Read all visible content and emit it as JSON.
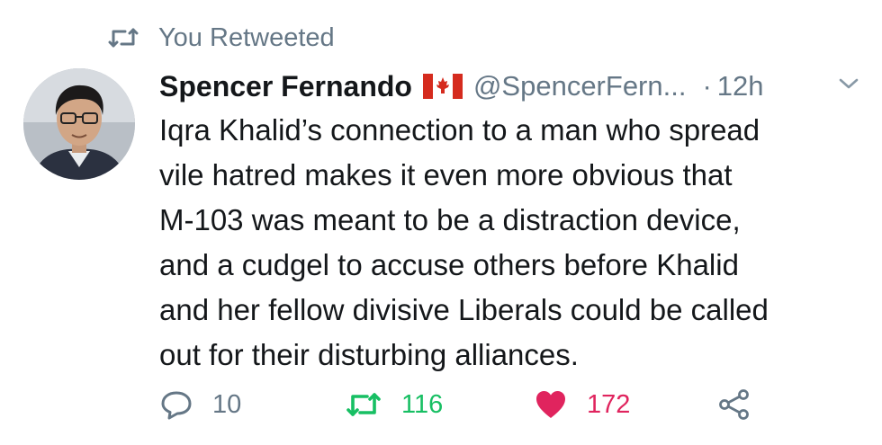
{
  "retweet_banner": {
    "label": "You Retweeted",
    "icon": "retweet-icon"
  },
  "tweet": {
    "display_name": "Spencer Fernando",
    "flag_icon": "canada-flag-icon",
    "handle": "@SpencerFern...",
    "separator": "·",
    "time": "12h",
    "text_lines": [
      "Iqra Khalid’s connection to a man who spread",
      "vile hatred makes it even more obvious that",
      "M-103 was meant to be a distraction device,",
      "and a cudgel to accuse others before Khalid",
      "and her fellow divisive Liberals could be called",
      "out for their disturbing alliances."
    ]
  },
  "actions": {
    "reply_count": "10",
    "retweet_count": "116",
    "like_count": "172"
  },
  "colors": {
    "muted": "#657786",
    "retweet_active": "#17bf63",
    "like_active": "#e0245e",
    "text": "#14171a"
  }
}
